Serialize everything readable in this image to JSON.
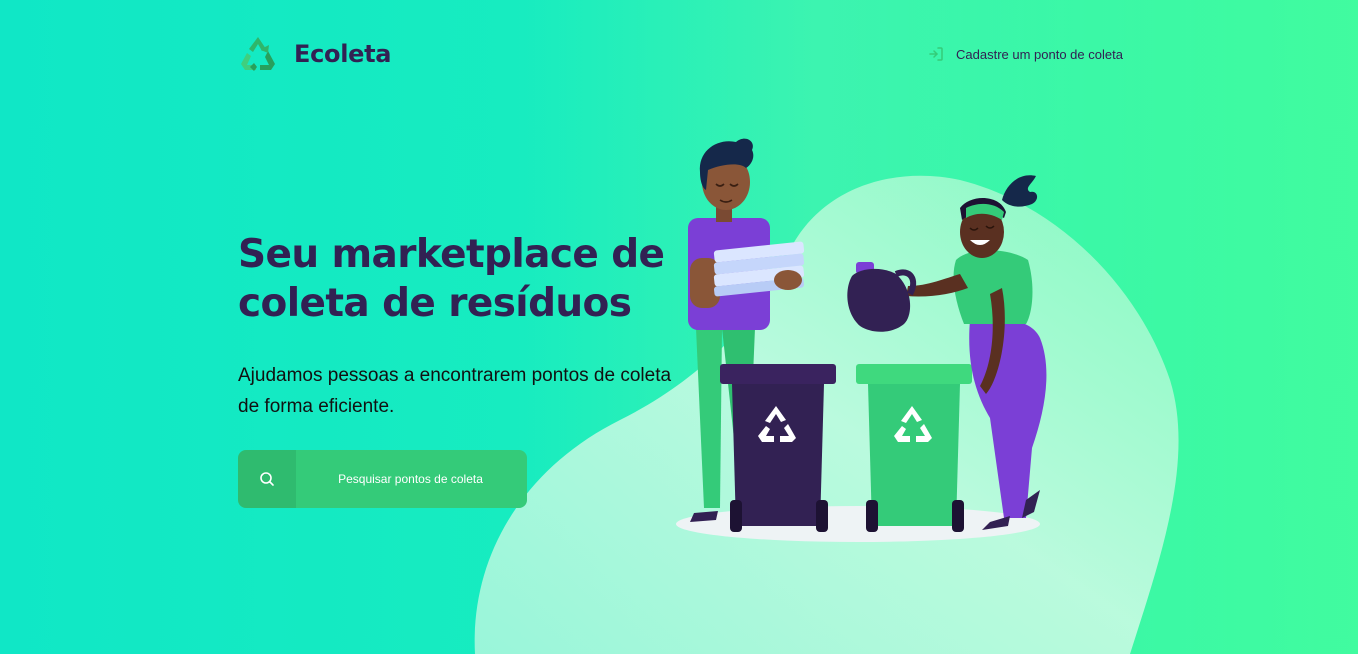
{
  "header": {
    "brand": "Ecoleta",
    "signup_link": "Cadastre um ponto de coleta",
    "logo_icon": "recycle-icon",
    "signup_icon": "log-in-icon"
  },
  "hero": {
    "title_line1": "Seu marketplace de",
    "title_line2": "coleta de resíduos",
    "subtitle_line1": "Ajudamos pessoas a encontrarem pontos de coleta",
    "subtitle_line2": "de forma eficiente.",
    "search_button": "Pesquisar pontos de coleta",
    "search_icon": "search-icon"
  },
  "colors": {
    "primary": "#34cb79",
    "title": "#322153",
    "background_start": "#10e7c6",
    "background_end": "#2bff8e"
  }
}
